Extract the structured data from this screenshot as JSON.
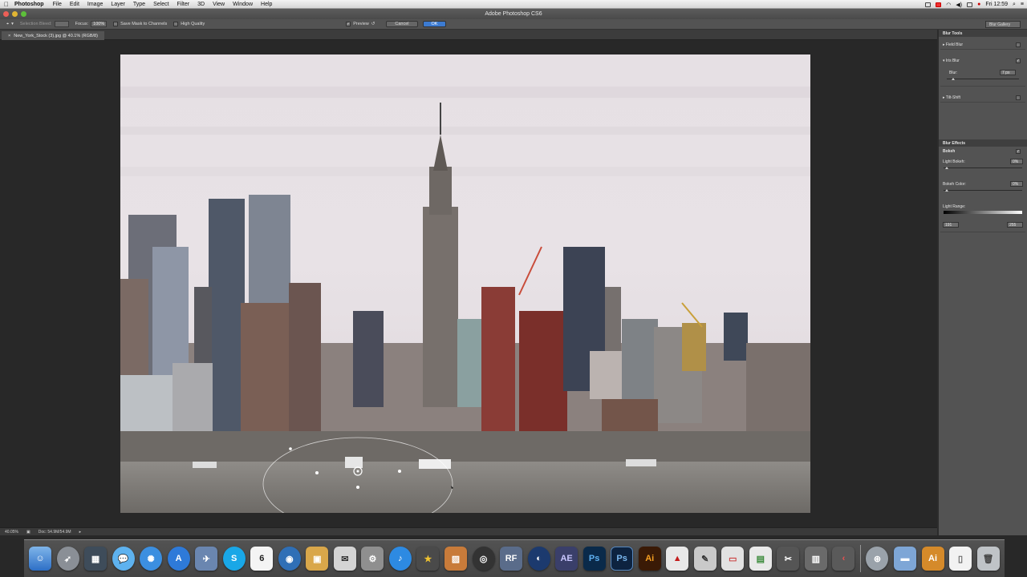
{
  "menubar": {
    "app_name": "Photoshop",
    "menus": [
      "File",
      "Edit",
      "Image",
      "Layer",
      "Type",
      "Select",
      "Filter",
      "3D",
      "View",
      "Window",
      "Help"
    ],
    "clock": "Fri 12:59"
  },
  "window": {
    "title": "Adobe Photoshop CS6"
  },
  "options": {
    "selection_bleed_label": "Selection Bleed:",
    "focus_label": "Focus:",
    "focus_value": "100%",
    "save_mask_label": "Save Mask to Channels",
    "high_quality_label": "High Quality",
    "preview_label": "Preview",
    "cancel_label": "Cancel",
    "ok_label": "OK",
    "workspace": "Blur Gallery"
  },
  "document": {
    "tab_title": "New_York_Stock (3).jpg @ 40.1% (RGB/8)"
  },
  "status": {
    "zoom": "40.05%",
    "doc_size": "Doc: 54.9M/54.9M"
  },
  "blur_tools": {
    "header": "Blur Tools",
    "field_blur": "Field Blur",
    "iris_blur": "Iris Blur",
    "blur_label": "Blur:",
    "blur_value": "7 px",
    "blur_level": 0.07,
    "tilt_shift": "Tilt-Shift"
  },
  "blur_effects": {
    "header": "Blur Effects",
    "bokeh": "Bokeh",
    "light_bokeh_label": "Light Bokeh:",
    "light_bokeh_value": "0%",
    "bokeh_color_label": "Bokeh Color:",
    "bokeh_color_value": "0%",
    "light_range_label": "Light Range:",
    "light_range_low": "191",
    "light_range_high": "255"
  },
  "colors": {
    "accent": "#3c7bd1",
    "panel": "#535353",
    "canvas_bg": "#282828"
  },
  "dock": {
    "icons": [
      "finder-icon",
      "launchpad-icon",
      "mission-control-icon",
      "messages-icon",
      "safari-icon",
      "app-store-icon",
      "preview-icon",
      "skype-icon",
      "calendar-icon",
      "system-icon",
      "package-icon",
      "mail-icon",
      "settings-icon",
      "itunes-icon",
      "imovie-icon",
      "iphoto-icon",
      "aperture-icon",
      "rf-icon",
      "cinema4d-icon",
      "after-effects-icon",
      "photoshop-icon",
      "photoshop-cs6-icon",
      "illustrator-icon",
      "acrobat-icon",
      "pen-icon",
      "presentation-icon",
      "chart-icon",
      "final-cut-icon",
      "clapper-icon",
      "motion-icon",
      "network-icon",
      "folder-icon",
      "ai-folder-icon",
      "document-icon",
      "trash-icon"
    ],
    "calendar_day": "6"
  }
}
